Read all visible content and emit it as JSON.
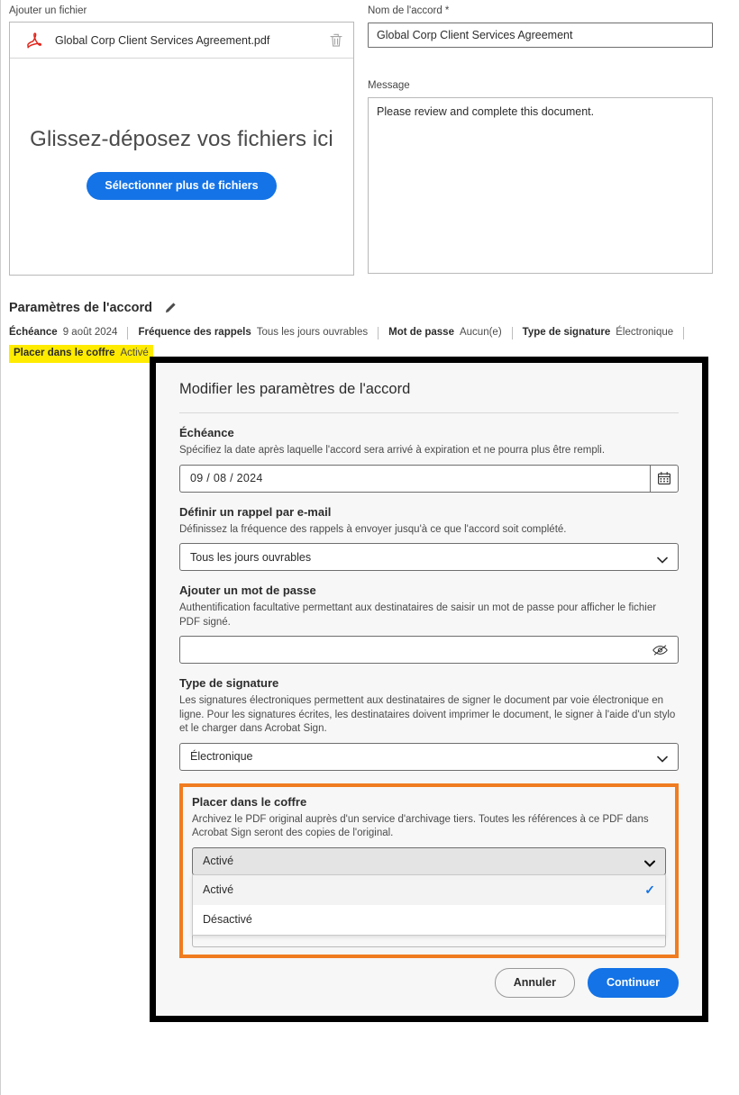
{
  "file_section": {
    "label": "Ajouter un fichier",
    "file_name": "Global Corp Client Services Agreement.pdf",
    "drop_title": "Glissez-déposez vos fichiers ici",
    "select_more_button": "Sélectionner plus de fichiers",
    "pdf_icon": "pdf-icon",
    "delete_icon": "trash-icon"
  },
  "agreement_name": {
    "label": "Nom de l'accord *",
    "value": "Global Corp Client Services Agreement"
  },
  "message": {
    "label": "Message",
    "value": "Please review and complete this document."
  },
  "settings_summary": {
    "title": "Paramètres de l'accord",
    "edit_icon": "pencil-icon",
    "items": [
      {
        "key": "Échéance",
        "value": "9 août 2024"
      },
      {
        "key": "Fréquence des rappels",
        "value": "Tous les jours ouvrables"
      },
      {
        "key": "Mot de passe",
        "value": "Aucun(e)"
      },
      {
        "key": "Type de signature",
        "value": "Électronique"
      }
    ],
    "highlighted": {
      "key": "Placer dans le coffre",
      "value": "Activé",
      "highlight_color": "#ffeb00"
    }
  },
  "modal": {
    "title": "Modifier les paramètres de l'accord",
    "deadline": {
      "heading": "Échéance",
      "description": "Spécifiez la date après laquelle l'accord sera arrivé à expiration et ne pourra plus être rempli.",
      "value": "09 /   08 / 2024",
      "calendar_icon": "calendar-icon"
    },
    "reminder": {
      "heading": "Définir un rappel par e-mail",
      "description": "Définissez la fréquence des rappels à envoyer jusqu'à ce que l'accord soit complété.",
      "value": "Tous les jours ouvrables"
    },
    "password": {
      "heading": "Ajouter un mot de passe",
      "description": "Authentification facultative permettant aux destinataires de saisir un mot de passe pour afficher le fichier PDF signé.",
      "value": "",
      "toggle_icon": "eye-off-icon"
    },
    "signature_type": {
      "heading": "Type de signature",
      "description": "Les signatures électroniques permettent aux destinataires de signer le document par voie électronique en ligne. Pour les signatures écrites, les destinataires doivent imprimer le document, le signer à l'aide d'un stylo et le charger dans Acrobat Sign.",
      "value": "Électronique"
    },
    "vault": {
      "heading": "Placer dans le coffre",
      "description": "Archivez le PDF original auprès d'un service d'archivage tiers. Toutes les références à ce PDF dans Acrobat Sign seront des copies de l'original.",
      "value": "Activé",
      "highlight_color": "#f07c20",
      "options": [
        {
          "label": "Activé",
          "selected": true
        },
        {
          "label": "Désactivé",
          "selected": false
        }
      ]
    },
    "cancel_button": "Annuler",
    "continue_button": "Continuer"
  },
  "colors": {
    "accent_blue": "#1473e6",
    "highlight_yellow": "#ffeb00",
    "highlight_orange": "#f07c20",
    "pdf_red": "#e1251b"
  }
}
